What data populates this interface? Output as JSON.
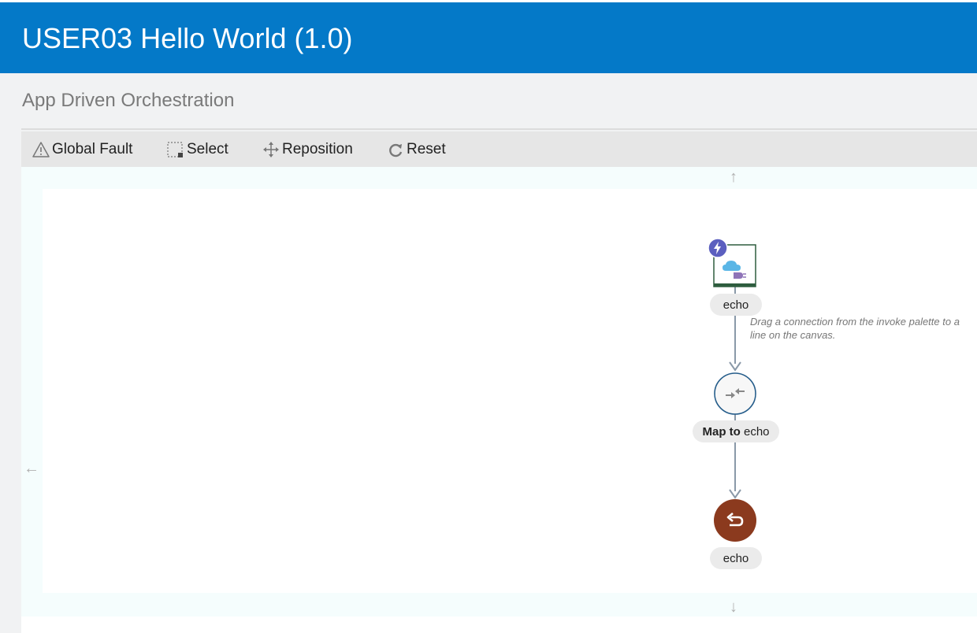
{
  "header": {
    "title": "USER03 Hello World (1.0)"
  },
  "page": {
    "subtitle": "App Driven Orchestration"
  },
  "toolbar": {
    "global_fault": "Global Fault",
    "select": "Select",
    "reposition": "Reposition",
    "reset": "Reset"
  },
  "canvas": {
    "hint": "Drag a connection from the invoke palette to a line on the canvas.",
    "trigger_label": "echo",
    "map_label_bold": "Map to",
    "map_label_rest": " echo",
    "return_label": "echo",
    "nav_up": "↑",
    "nav_down": "↓",
    "nav_left": "←"
  },
  "colors": {
    "header_bg": "#0479c8",
    "return_node": "#8b3a1e",
    "trigger_badge": "#5b5fbf",
    "map_ring": "#245c8a",
    "connector": "#8a99a8"
  },
  "icons": [
    "warning-icon",
    "select-icon",
    "reposition-icon",
    "reset-icon",
    "lightning-icon",
    "cloud-plug-icon",
    "map-icon",
    "return-icon"
  ]
}
